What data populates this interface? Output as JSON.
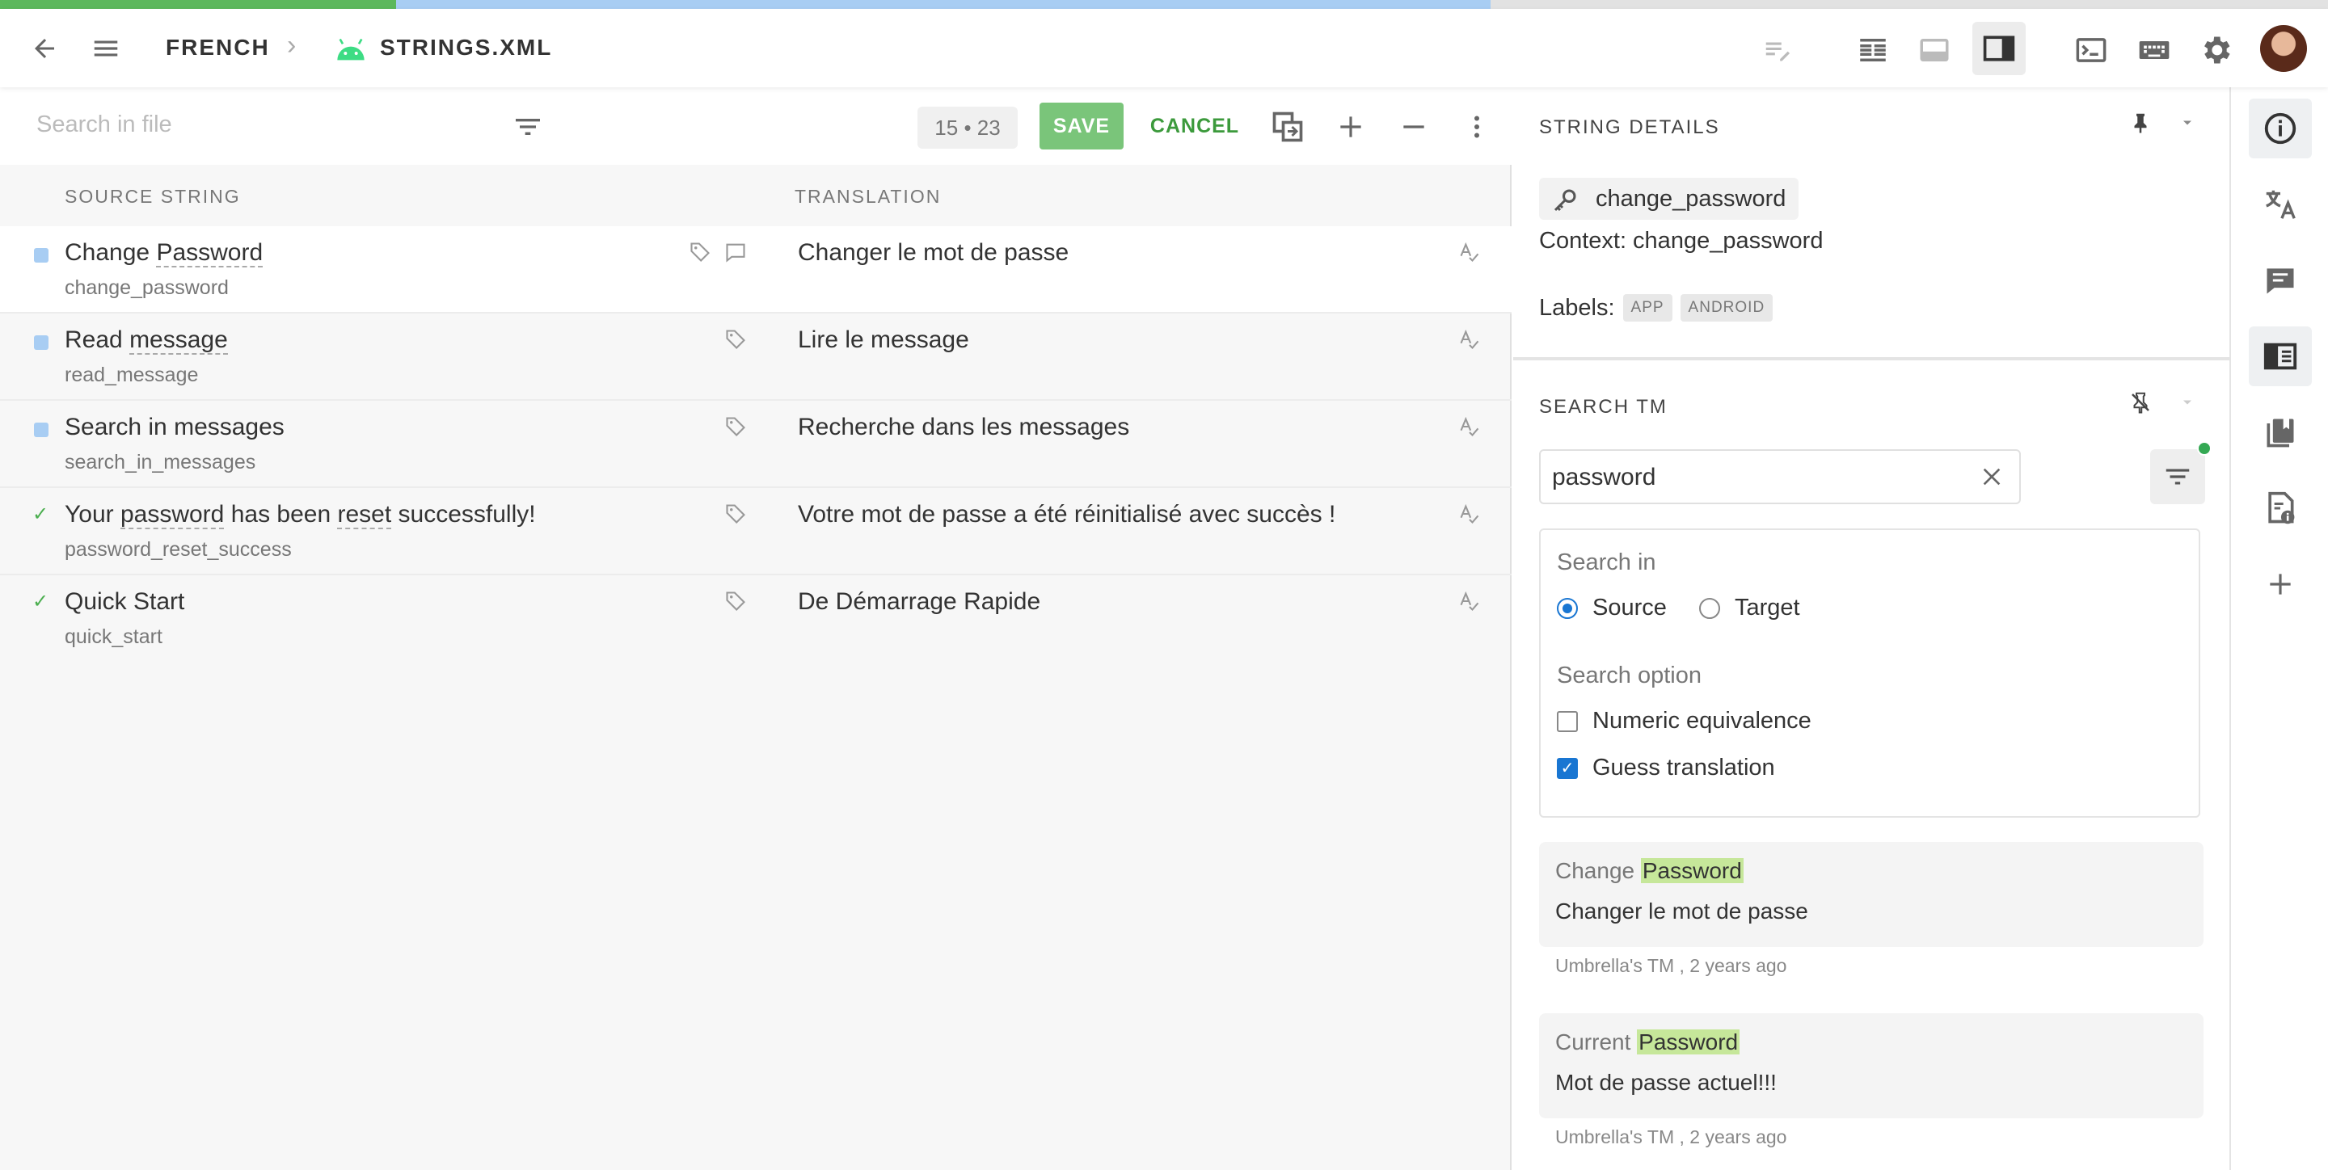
{
  "header": {
    "breadcrumb_project": "FRENCH",
    "breadcrumb_file": "STRINGS.XML",
    "progress_translated_fraction": 0.17,
    "progress_draft_fraction": 0.47
  },
  "toolbar": {
    "search_placeholder": "Search in file",
    "counter": "15 • 23",
    "save_label": "SAVE",
    "cancel_label": "CANCEL"
  },
  "columns": {
    "source": "SOURCE STRING",
    "translation": "TRANSLATION"
  },
  "rows": [
    {
      "source": "Change Password",
      "key": "change_password",
      "translation": "Changer le mot de passe",
      "status": "draft"
    },
    {
      "source": "Read message",
      "key": "read_message",
      "translation": "Lire le message",
      "status": "draft"
    },
    {
      "source": "Search in messages",
      "key": "search_in_messages",
      "translation": "Recherche dans les messages",
      "status": "draft"
    },
    {
      "source": "Your password has been reset successfully!",
      "key": "password_reset_success",
      "translation": "Votre mot de passe a été réinitialisé avec succès !",
      "status": "translated"
    },
    {
      "source": "Quick Start",
      "key": "quick_start",
      "translation": "De Démarrage Rapide",
      "status": "translated"
    }
  ],
  "details": {
    "title": "STRING DETAILS",
    "key": "change_password",
    "context": "Context: change_password",
    "labels_label": "Labels:",
    "labels": [
      "APP",
      "ANDROID"
    ]
  },
  "tm": {
    "title": "SEARCH TM",
    "query": "password",
    "search_in_label": "Search in",
    "source_option": "Source",
    "target_option": "Target",
    "search_option_label": "Search option",
    "numeric_label": "Numeric equivalence",
    "guess_label": "Guess translation",
    "results": [
      {
        "source_prefix": "Change ",
        "source_match": "Password",
        "target": "Changer le mot de passe",
        "meta": "Umbrella's TM , 2 years ago"
      },
      {
        "source_prefix": "Current ",
        "source_match": "Password",
        "target": "Mot de passe actuel!!!",
        "meta": "Umbrella's TM , 2 years ago"
      }
    ]
  },
  "colors": {
    "accent": "#1976d2",
    "save": "#7ac57a",
    "cancel": "#3c9a3c",
    "draft": "#a8cdf3",
    "translated": "#5cb85c",
    "highlight": "#c6e79a"
  }
}
